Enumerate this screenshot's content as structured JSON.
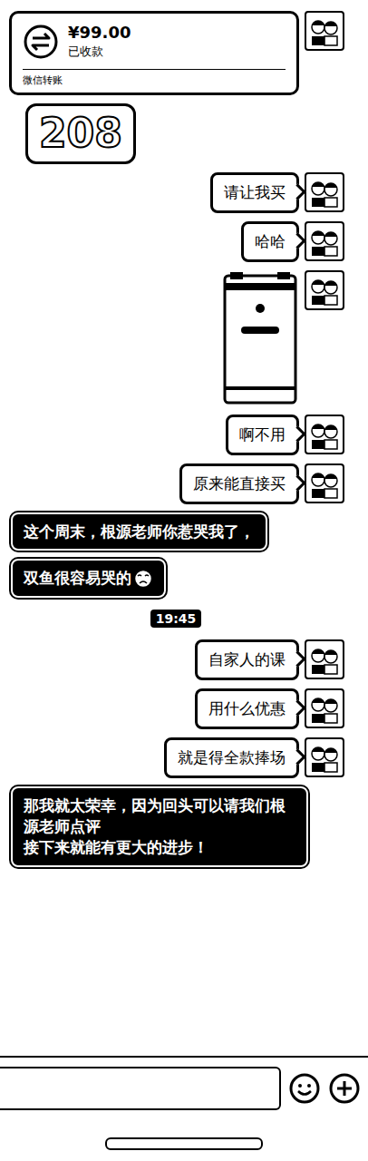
{
  "messages": [
    {
      "kind": "transfer",
      "side": "right",
      "amount": "¥99.00",
      "status": "已收款",
      "footer": "微信转账"
    },
    {
      "kind": "sticker",
      "side": "left",
      "text": "208"
    },
    {
      "kind": "text",
      "side": "right",
      "text": "请让我买",
      "has_emoji": false
    },
    {
      "kind": "text",
      "side": "right",
      "text": "哈哈",
      "has_emoji": false
    },
    {
      "kind": "image",
      "side": "right"
    },
    {
      "kind": "text",
      "side": "right",
      "text": "啊不用",
      "has_emoji": false
    },
    {
      "kind": "text",
      "side": "right",
      "text": "原来能直接买",
      "has_emoji": false
    },
    {
      "kind": "text",
      "side": "left",
      "text": "这个周末，根源老师你惹哭我了，",
      "has_emoji": false
    },
    {
      "kind": "text",
      "side": "left",
      "text": "双鱼很容易哭的",
      "has_emoji": true
    },
    {
      "kind": "time",
      "side": "center",
      "text": "19:45"
    },
    {
      "kind": "text",
      "side": "right",
      "text": "自家人的课",
      "has_emoji": false
    },
    {
      "kind": "text",
      "side": "right",
      "text": "用什么优惠",
      "has_emoji": false
    },
    {
      "kind": "text",
      "side": "right",
      "text": "就是得全款捧场",
      "has_emoji": false
    },
    {
      "kind": "text",
      "side": "left",
      "text": "那我就太荣幸，因为回头可以请我们根源老师点评\n接下来就能有更大的进步！",
      "has_emoji": false
    }
  ]
}
